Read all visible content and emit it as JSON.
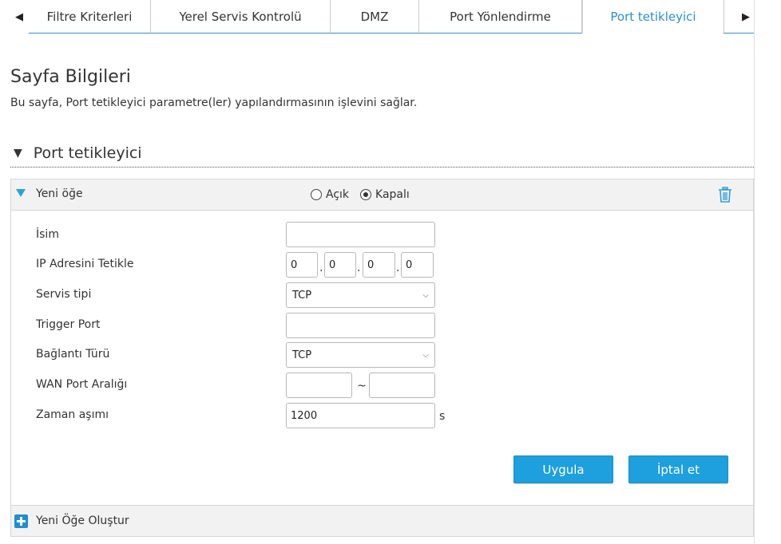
{
  "tabs": [
    {
      "label": "Filtre Kriterleri"
    },
    {
      "label": "Yerel Servis Kontrolü"
    },
    {
      "label": "DMZ"
    },
    {
      "label": "Port Yönlendirme"
    },
    {
      "label": "Port tetikleyici"
    }
  ],
  "page": {
    "title": "Sayfa Bilgileri",
    "description": "Bu sayfa, Port tetikleyici parametre(ler) yapılandırmasının işlevini sağlar."
  },
  "section": {
    "title": "Port tetikleyici"
  },
  "item": {
    "title": "Yeni öğe",
    "radio_on": "Açık",
    "radio_off": "Kapalı",
    "selected": "Kapalı"
  },
  "form": {
    "name_label": "İsim",
    "name_value": "",
    "ip_label": "IP Adresini Tetikle",
    "ip": [
      "0",
      "0",
      "0",
      "0"
    ],
    "service_label": "Servis tipi",
    "service_value": "TCP",
    "trigger_label": "Trigger Port",
    "trigger_value": "",
    "conn_label": "Bağlantı Türü",
    "conn_value": "TCP",
    "wan_label": "WAN Port Aralığı",
    "wan_from": "",
    "wan_to": "",
    "wan_sep": "~",
    "timeout_label": "Zaman aşımı",
    "timeout_value": "1200",
    "timeout_unit": "s"
  },
  "buttons": {
    "apply": "Uygula",
    "cancel": "İptal et"
  },
  "create": {
    "label": "Yeni Öğe Oluştur"
  },
  "colors": {
    "accent": "#1e9fde",
    "active_tab_text": "#2a8fd4"
  }
}
